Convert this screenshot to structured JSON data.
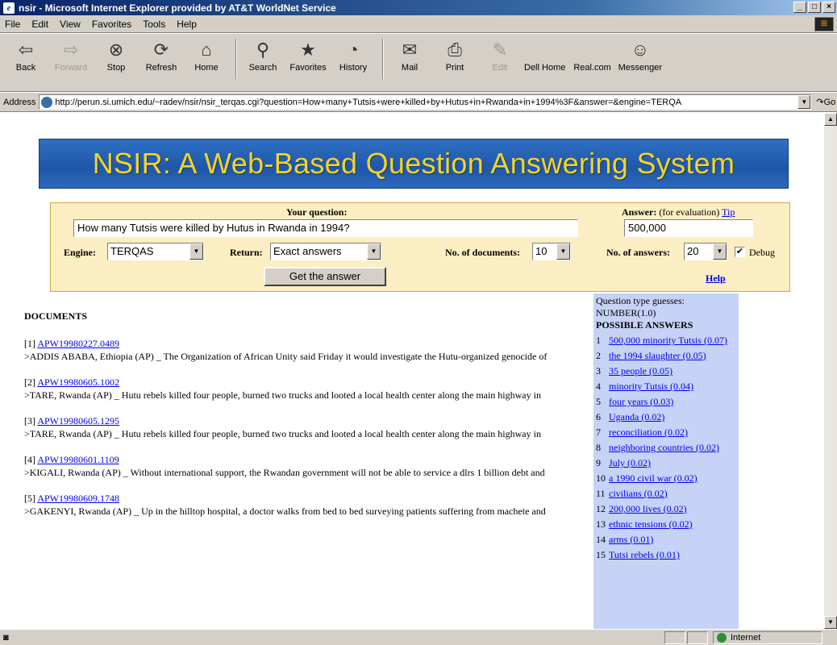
{
  "window": {
    "title": "nsir - Microsoft Internet Explorer provided by AT&T WorldNet Service",
    "controls": [
      "_",
      "□",
      "×"
    ]
  },
  "menu": [
    "File",
    "Edit",
    "View",
    "Favorites",
    "Tools",
    "Help"
  ],
  "toolbar": {
    "back": "Back",
    "forward": "Forward",
    "stop": "Stop",
    "refresh": "Refresh",
    "home": "Home",
    "search": "Search",
    "favorites": "Favorites",
    "history": "History",
    "mail": "Mail",
    "print": "Print",
    "edit": "Edit",
    "dell_home": "Dell Home",
    "real_com": "Real.com",
    "messenger": "Messenger"
  },
  "address": {
    "label": "Address",
    "url": "http://perun.si.umich.edu/~radev/nsir/nsir_terqas.cgi?question=How+many+Tutsis+were+killed+by+Hutus+in+Rwanda+in+1994%3F&answer=&engine=TERQA",
    "go": "Go"
  },
  "banner": {
    "title": "NSIR: A Web-Based Question Answering System"
  },
  "form": {
    "question_label": "Your question:",
    "question_value": "How many Tutsis were killed by Hutus in Rwanda in 1994?",
    "answer_label": "Answer:",
    "answer_note": "(for evaluation)",
    "tip": "Tip",
    "answer_value": "500,000",
    "engine_label": "Engine:",
    "engine_value": "TERQAS",
    "return_label": "Return:",
    "return_value": "Exact answers",
    "ndocs_label": "No. of documents:",
    "ndocs_value": "10",
    "nanswers_label": "No. of answers:",
    "nanswers_value": "20",
    "debug_label": "Debug",
    "debug_checked": "✔",
    "submit": "Get the answer",
    "help": "Help"
  },
  "documents": {
    "header": "DOCUMENTS",
    "items": [
      {
        "num": "[1]",
        "id": "APW19980227.0489",
        "text": ">ADDIS ABABA, Ethiopia (AP) _ The Organization of African Unity said Friday it would investigate the Hutu-organized genocide of"
      },
      {
        "num": "[2]",
        "id": "APW19980605.1002",
        "text": ">TARE, Rwanda (AP) _ Hutu rebels killed four people, burned two trucks and looted a local health center along the main highway in"
      },
      {
        "num": "[3]",
        "id": "APW19980605.1295",
        "text": ">TARE, Rwanda (AP) _ Hutu rebels killed four people, burned two trucks and looted a local health center along the main highway in"
      },
      {
        "num": "[4]",
        "id": "APW19980601.1109",
        "text": ">KIGALI, Rwanda (AP) _ Without international support, the Rwandan government will not be able to service a dlrs 1 billion debt and"
      },
      {
        "num": "[5]",
        "id": "APW19980609.1748",
        "text": ">GAKENYI, Rwanda (AP) _ Up in the hilltop hospital, a doctor walks from bed to bed surveying patients suffering from machete and"
      }
    ]
  },
  "answers": {
    "type_label": "Question type guesses:",
    "type_value": "NUMBER(1.0)",
    "header": "POSSIBLE ANSWERS",
    "items": [
      {
        "n": "1",
        "text": "500,000 minority Tutsis (0.07)"
      },
      {
        "n": "2",
        "text": "the 1994 slaughter (0.05)"
      },
      {
        "n": "3",
        "text": "35 people (0.05)"
      },
      {
        "n": "4",
        "text": "minority Tutsis (0.04)"
      },
      {
        "n": "5",
        "text": "four years (0.03)"
      },
      {
        "n": "6",
        "text": "Uganda (0.02)"
      },
      {
        "n": "7",
        "text": "reconciliation (0.02)"
      },
      {
        "n": "8",
        "text": "neighboring countries (0.02)"
      },
      {
        "n": "9",
        "text": "July (0.02)"
      },
      {
        "n": "10",
        "text": "a 1990 civil war (0.02)"
      },
      {
        "n": "11",
        "text": "civilians (0.02)"
      },
      {
        "n": "12",
        "text": "200,000 lives (0.02)"
      },
      {
        "n": "13",
        "text": "ethnic tensions (0.02)"
      },
      {
        "n": "14",
        "text": "arms (0.01)"
      },
      {
        "n": "15",
        "text": "Tutsi rebels (0.01)"
      }
    ]
  },
  "status": {
    "zone": "Internet"
  }
}
